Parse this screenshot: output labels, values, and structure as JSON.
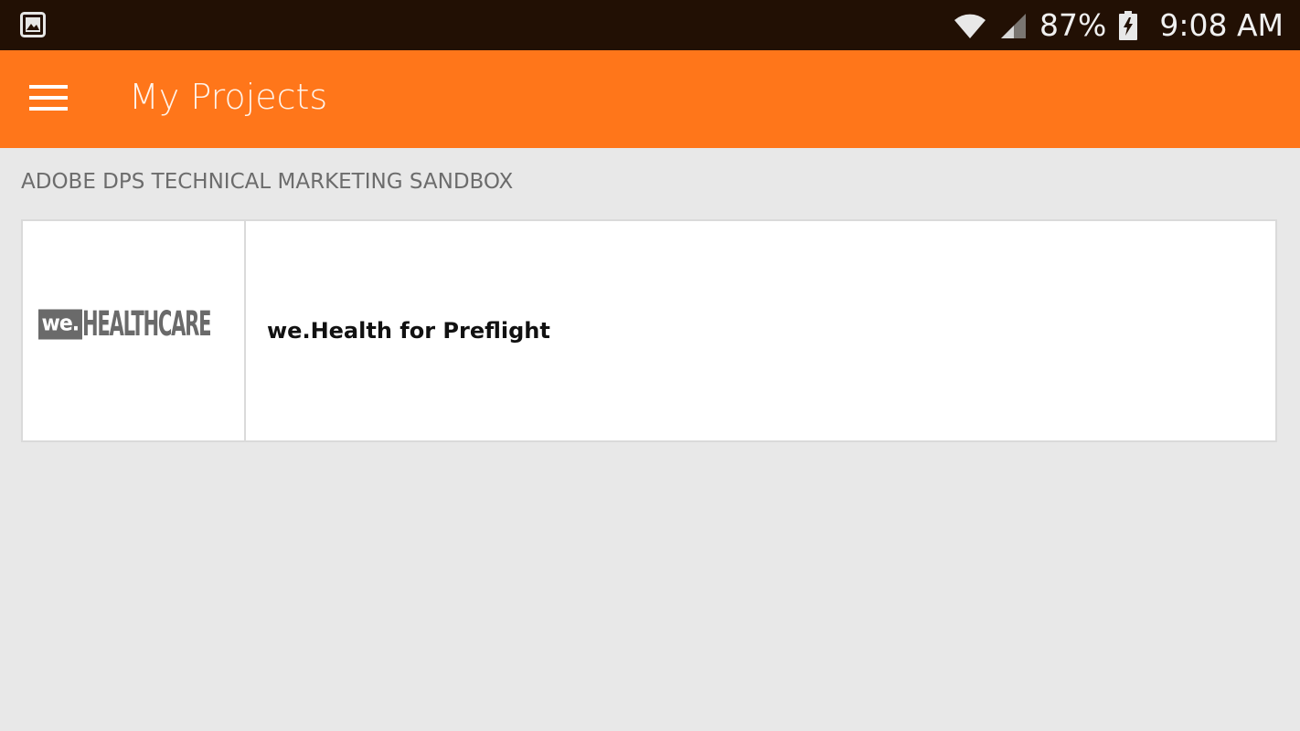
{
  "status_bar": {
    "left_icon": "gallery-notification-icon",
    "battery_percent": "87%",
    "time": "9:08 AM",
    "icons": [
      "wifi-icon",
      "cell-signal-icon",
      "battery-charging-icon"
    ]
  },
  "app_bar": {
    "menu_icon": "hamburger-menu-icon",
    "title": "My Projects",
    "color": "#ff761a"
  },
  "section": {
    "header": "ADOBE DPS TECHNICAL MARKETING SANDBOX"
  },
  "projects": [
    {
      "logo_we": "we.",
      "logo_brand": "HEALTHCARE",
      "title": "we.Health for Preflight"
    }
  ]
}
